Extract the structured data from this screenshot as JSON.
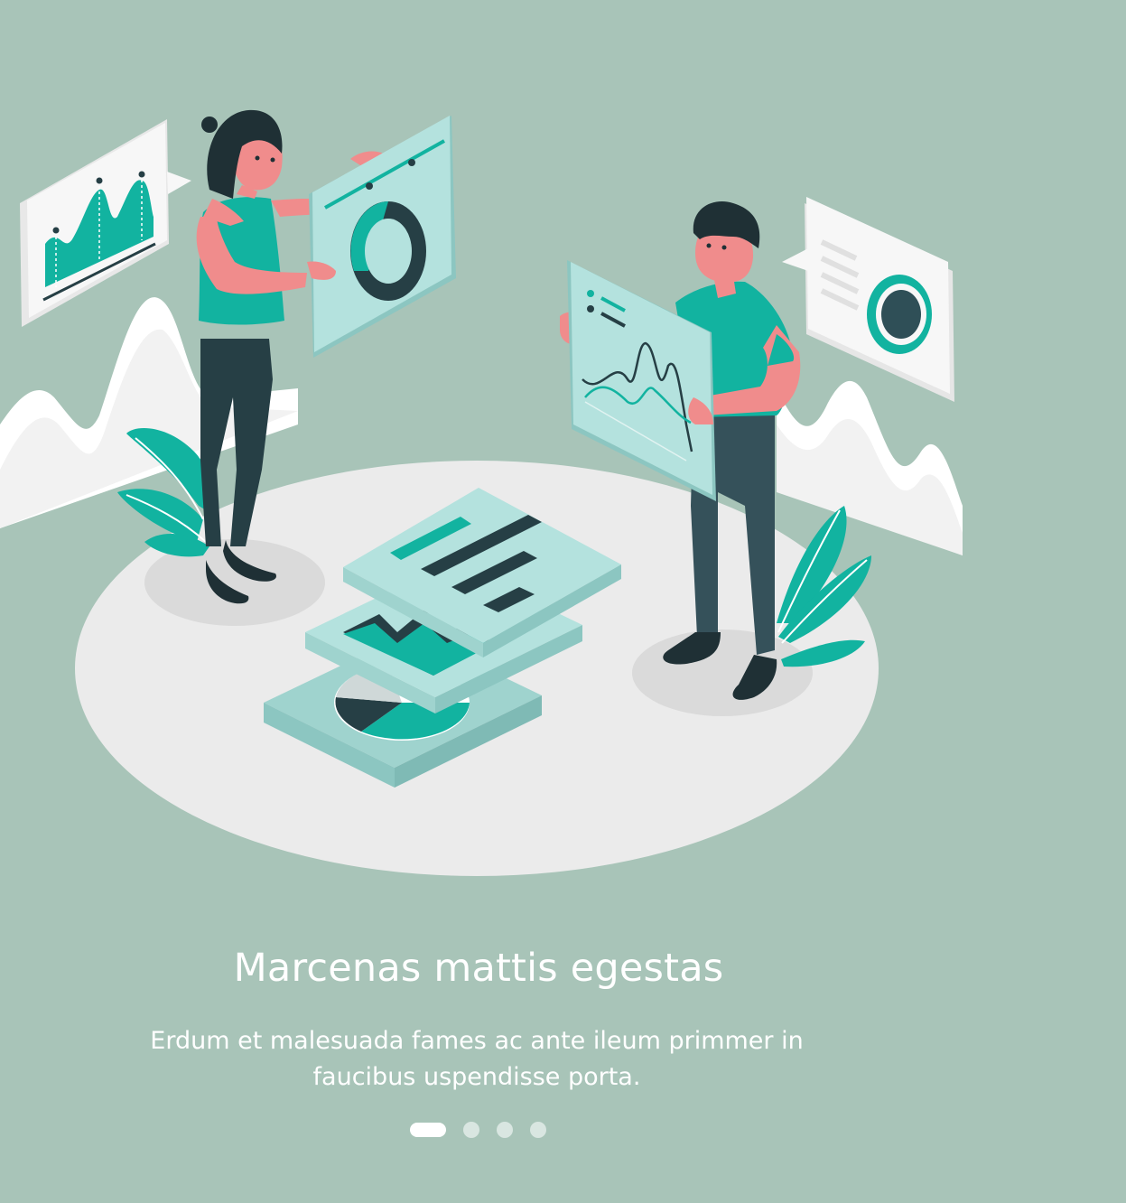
{
  "onboarding": {
    "title": "Marcenas mattis egestas",
    "description": "Erdum et malesuada fames ac ante ileum primmer in faucibus uspendisse porta."
  },
  "pagination": {
    "current_page": 1,
    "total_pages": 4
  },
  "illustration": {
    "icon": "data-analysis-team-illustration",
    "colors": {
      "background": "#a8c4b8",
      "accent": "#12b3a0",
      "dark": "#263f45",
      "skin": "#f08c8c",
      "panel": "#b4e2de",
      "floor": "#ebebeb"
    }
  }
}
